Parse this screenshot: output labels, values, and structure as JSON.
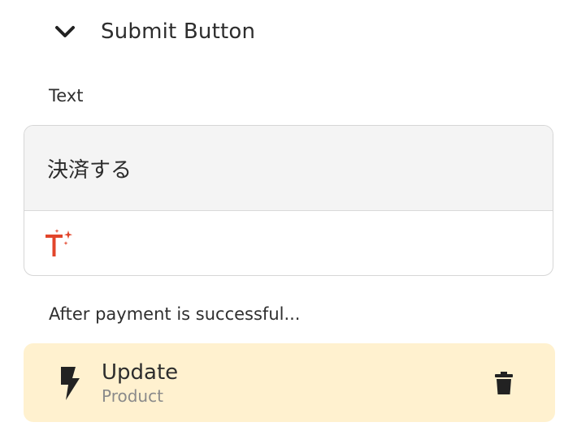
{
  "section": {
    "title": "Submit Button",
    "icon": "chevron-down-icon"
  },
  "text_field": {
    "label": "Text",
    "value": "決済する",
    "ai_icon": "text-sparkle-icon"
  },
  "after_payment": {
    "label": "After payment is successful...",
    "action": {
      "title": "Update",
      "subtitle": "Product",
      "icon": "lightning-icon",
      "delete_icon": "trash-icon"
    }
  },
  "colors": {
    "accent_red": "#e2452b",
    "action_bg": "#fff1cf",
    "input_bg": "#f4f4f4"
  }
}
